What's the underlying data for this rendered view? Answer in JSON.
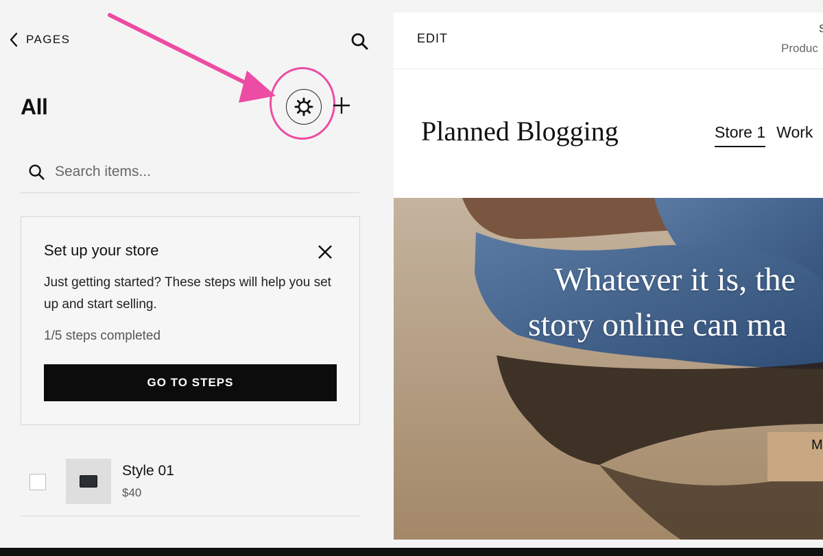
{
  "header": {
    "back_label": "PAGES"
  },
  "panel": {
    "title": "All"
  },
  "search": {
    "placeholder": "Search items..."
  },
  "store_card": {
    "title": "Set up your store",
    "description": "Just getting started? These steps will help you set up and start selling.",
    "progress": "1/5 steps completed",
    "button_label": "GO TO STEPS"
  },
  "products": [
    {
      "name": "Style 01",
      "price": "$40"
    }
  ],
  "preview": {
    "edit_label": "EDIT",
    "top_right_1": "S",
    "top_right_2": "Produc",
    "site_title": "Planned Blogging",
    "nav": [
      "Store 1",
      "Work"
    ],
    "hero_line_1": "Whatever it is, the",
    "hero_line_2": "story online can ma",
    "hero_button": "M"
  },
  "colors": {
    "highlight": "#ec4ca3",
    "button_bg": "#0c0c0c",
    "hero_button_bg": "#c7a883"
  },
  "icons": [
    "chevron-left-icon",
    "search-icon",
    "gear-icon",
    "plus-icon",
    "close-icon"
  ]
}
